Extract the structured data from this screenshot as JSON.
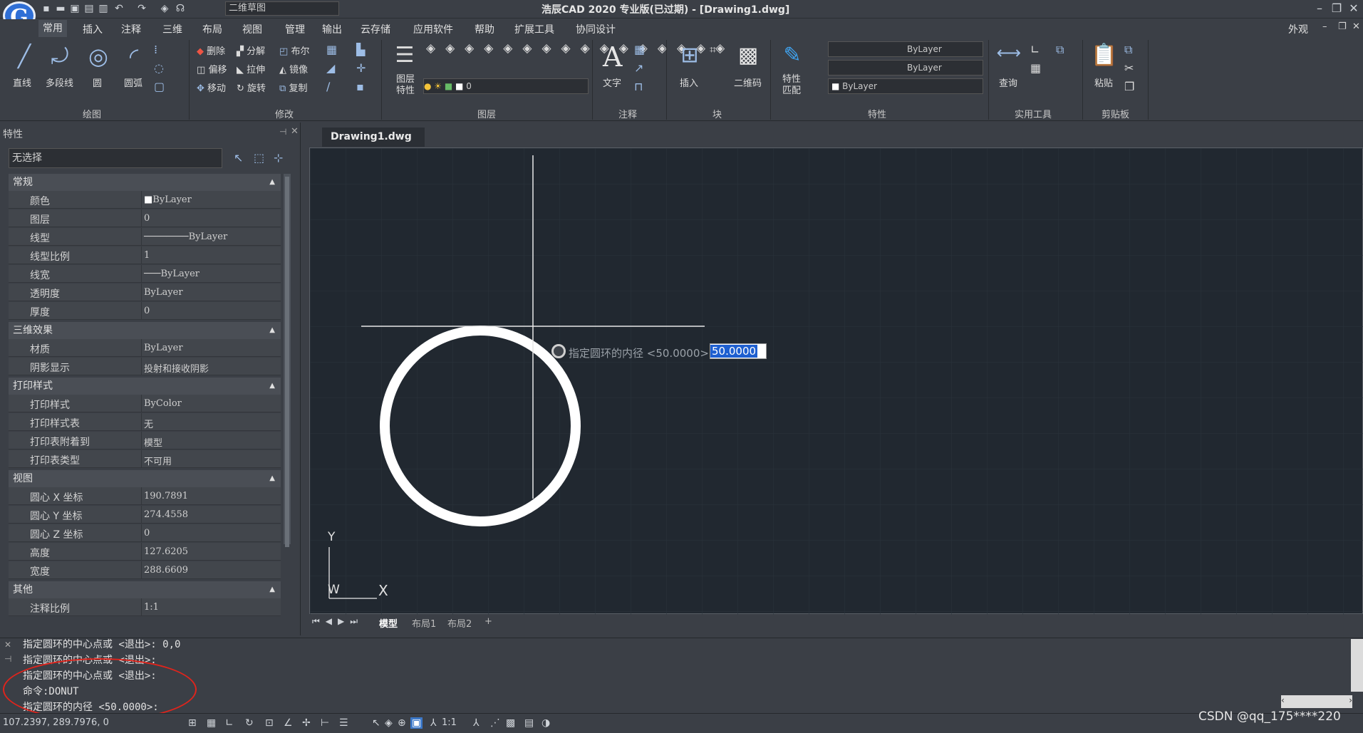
{
  "app": {
    "logo": "G",
    "title": "浩辰CAD 2020 专业版(已过期) - [Drawing1.dwg]",
    "workspace": "二维草图"
  },
  "menu": [
    "常用",
    "插入",
    "注释",
    "三维",
    "布局",
    "视图",
    "管理",
    "输出",
    "云存储",
    "应用软件",
    "帮助",
    "扩展工具",
    "协同设计"
  ],
  "menu_right": "外观",
  "ribbon": {
    "draw": {
      "line": "直线",
      "polyline": "多段线",
      "circle": "圆",
      "arc": "圆弧",
      "label": "绘图"
    },
    "modify": {
      "delete": "删除",
      "explode": "分解",
      "boolean": "布尔",
      "offset": "偏移",
      "stretch": "拉伸",
      "mirror": "镜像",
      "move": "移动",
      "rotate": "旋转",
      "copy": "复制",
      "label": "修改"
    },
    "layer": {
      "props": "图层\n特性",
      "current": "0",
      "label": "图层"
    },
    "annot": {
      "text": "文字",
      "label": "注释"
    },
    "block": {
      "insert": "插入",
      "qr": "二维码",
      "label": "块"
    },
    "props": {
      "match": "特性\n匹配",
      "color": "ByLayer",
      "linetype": "ByLayer",
      "lineweight": "ByLayer",
      "label": "特性"
    },
    "util": {
      "query": "查询",
      "label": "实用工具"
    },
    "clip": {
      "paste": "粘贴",
      "label": "剪贴板"
    }
  },
  "panel": {
    "title": "特性",
    "selection": "无选择"
  },
  "sections": [
    {
      "title": "常规",
      "rows": [
        [
          "颜色",
          "ByLayer"
        ],
        [
          "图层",
          "0"
        ],
        [
          "线型",
          "ByLayer"
        ],
        [
          "线型比例",
          "1"
        ],
        [
          "线宽",
          "ByLayer"
        ],
        [
          "透明度",
          "ByLayer"
        ],
        [
          "厚度",
          "0"
        ]
      ]
    },
    {
      "title": "三维效果",
      "rows": [
        [
          "材质",
          "ByLayer"
        ],
        [
          "阴影显示",
          "投射和接收阴影"
        ]
      ]
    },
    {
      "title": "打印样式",
      "rows": [
        [
          "打印样式",
          "ByColor"
        ],
        [
          "打印样式表",
          "无"
        ],
        [
          "打印表附着到",
          "模型"
        ],
        [
          "打印表类型",
          "不可用"
        ]
      ]
    },
    {
      "title": "视图",
      "rows": [
        [
          "圆心 X 坐标",
          "190.7891"
        ],
        [
          "圆心 Y 坐标",
          "274.4558"
        ],
        [
          "圆心 Z 坐标",
          "0"
        ],
        [
          "高度",
          "127.6205"
        ],
        [
          "宽度",
          "288.6609"
        ]
      ]
    },
    {
      "title": "其他",
      "rows": [
        [
          "注释比例",
          "1:1"
        ]
      ]
    }
  ],
  "doc_tab": "Drawing1.dwg",
  "prompt": {
    "text": "指定圆环的内径 <50.0000>:",
    "value": "50.0000"
  },
  "ucs": {
    "y": "Y",
    "x": "X",
    "w": "W"
  },
  "layout_tabs": [
    "模型",
    "布局1",
    "布局2",
    "+"
  ],
  "command_lines": [
    "指定圆环的中心点或 <退出>: 0,0",
    "指定圆环的中心点或 <退出>:",
    "指定圆环的中心点或 <退出>:",
    "命令:DONUT",
    "指定圆环的内径 <50.0000>:"
  ],
  "status": {
    "coords": "107.2397, 289.7976, 0",
    "scale": "1:1",
    "watermark": "CSDN @qq_175****220"
  },
  "colors": {
    "canvas": "#212830",
    "accent": "#1e5fd0",
    "highlight_circle": "#e0241c"
  }
}
